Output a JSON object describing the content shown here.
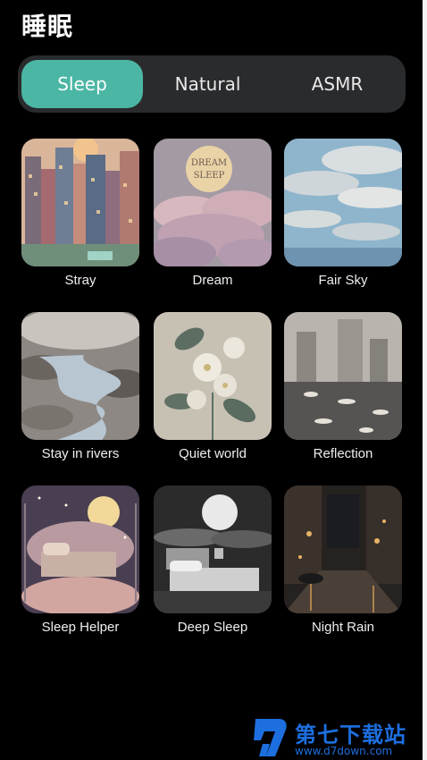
{
  "header": {
    "title": "睡眠"
  },
  "tabs": [
    {
      "label": "Sleep",
      "active": true
    },
    {
      "label": "Natural",
      "active": false
    },
    {
      "label": "ASMR",
      "active": false
    }
  ],
  "cards": [
    {
      "label": "Stray"
    },
    {
      "label": "Dream",
      "art_text": "DREAM SLEEP"
    },
    {
      "label": "Fair Sky"
    },
    {
      "label": "Stay in rivers"
    },
    {
      "label": "Quiet world"
    },
    {
      "label": "Reflection"
    },
    {
      "label": "Sleep Helper"
    },
    {
      "label": "Deep Sleep"
    },
    {
      "label": "Night Rain"
    }
  ],
  "watermark": {
    "name": "第七下载站",
    "url": "www.d7down.com"
  },
  "colors": {
    "accent": "#4bb6a4",
    "tab_bg": "#2a2b2d",
    "background": "#000000",
    "watermark": "#1d6fe0"
  }
}
